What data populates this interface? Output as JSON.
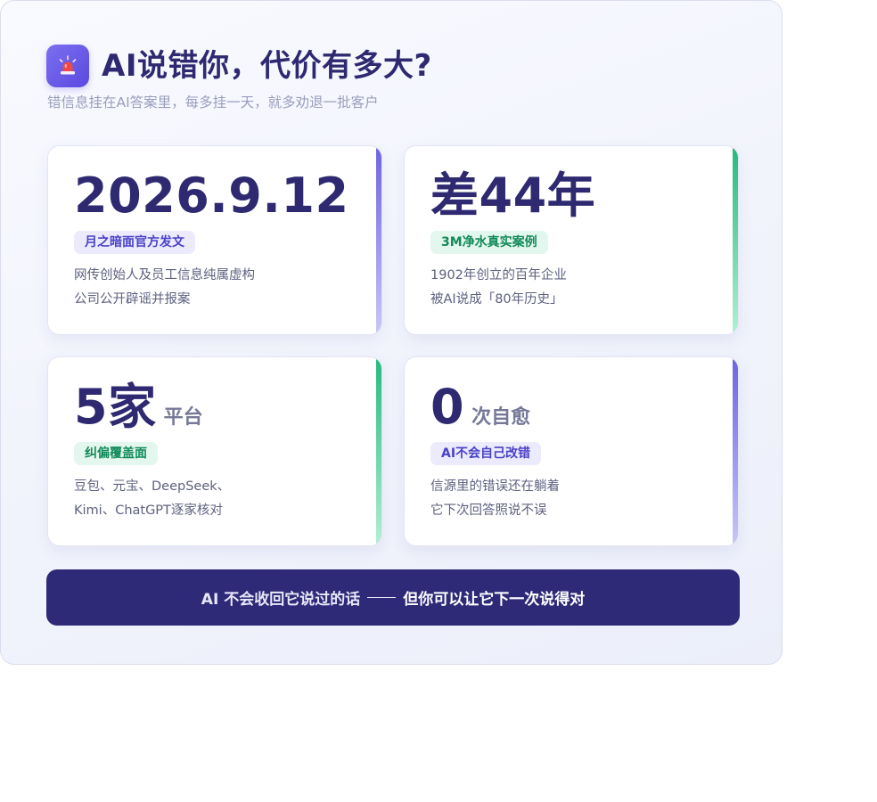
{
  "header": {
    "icon": "siren-icon",
    "title": "AI说错你，代价有多大?",
    "subtitle": "错信息挂在AI答案里，每多挂一天，就多劝退一批客户"
  },
  "cards": [
    {
      "value": "2026.9.12",
      "unit": "",
      "badge": "月之暗面官方发文",
      "lines": [
        "网传创始人及员工信息纯属虚构",
        "公司公开辟谣并报案"
      ],
      "accent": "#6e64e0"
    },
    {
      "value": "差44年",
      "unit": "",
      "badge": "3M净水真实案例",
      "lines": [
        "1902年创立的百年企业",
        "被AI说成「80年历史」"
      ],
      "accent": "#25b97f"
    },
    {
      "value": "5家",
      "unit": "平台",
      "badge": "纠偏覆盖面",
      "lines": [
        "豆包、元宝、DeepSeek、",
        "Kimi、ChatGPT逐家核对"
      ],
      "accent": "#25b97f"
    },
    {
      "value": "0",
      "unit": "次自愈",
      "badge": "AI不会自己改错",
      "lines": [
        "信源里的错误还在躺着",
        "它下次回答照说不误"
      ],
      "accent": "#6e64e0"
    }
  ],
  "banner": {
    "text_part1": "AI 不会收回它说过的话",
    "text_part2": "但你可以让它下一次说得对"
  }
}
